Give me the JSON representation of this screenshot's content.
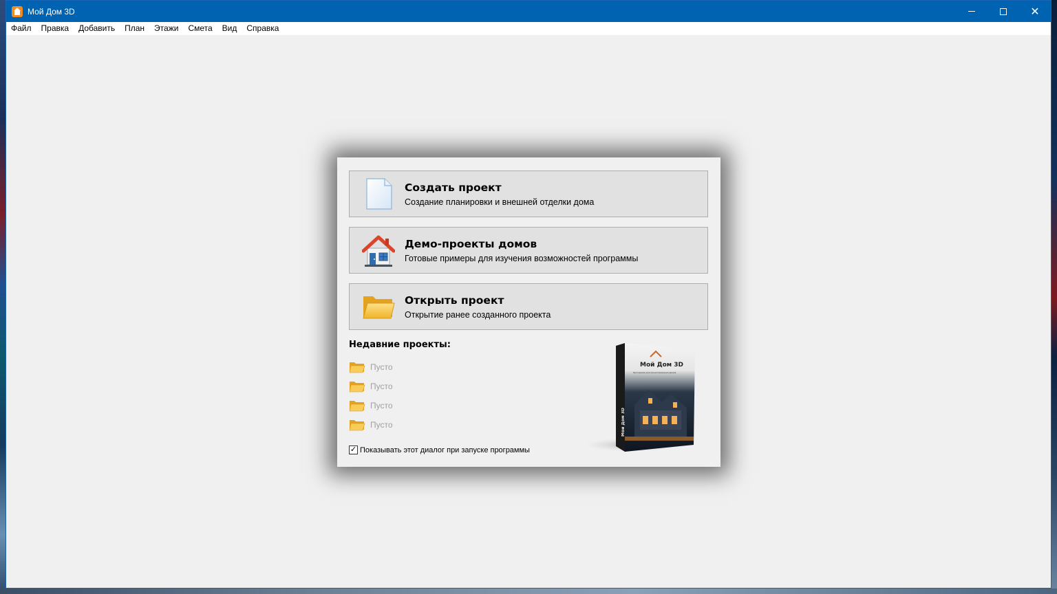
{
  "window": {
    "title": "Мой Дом 3D",
    "controls": {
      "minimize": "—",
      "maximize": "☐",
      "close": "✕"
    }
  },
  "menu": {
    "items": [
      "Файл",
      "Правка",
      "Добавить",
      "План",
      "Этажи",
      "Смета",
      "Вид",
      "Справка"
    ]
  },
  "dialog": {
    "actions": [
      {
        "title": "Создать проект",
        "subtitle": "Создание планировки и внешней отделки дома",
        "icon": "new-document-icon"
      },
      {
        "title": "Демо-проекты домов",
        "subtitle": "Готовые примеры для изучения возможностей программы",
        "icon": "house-icon"
      },
      {
        "title": "Открыть проект",
        "subtitle": "Открытие ранее созданного проекта",
        "icon": "open-folder-icon"
      }
    ],
    "recent_title": "Недавние проекты:",
    "recent": [
      "Пусто",
      "Пусто",
      "Пусто",
      "Пусто"
    ],
    "show_on_startup_label": "Показывать этот диалог при запуске программы",
    "show_on_startup_checked": true,
    "checkbox_mark": "✓",
    "box_brand": "Мой Дом 3D",
    "box_side": "Мой Дом 3D",
    "box_sub": "Программа для проектирования домов"
  },
  "colors": {
    "titlebar": "#0063b1",
    "button_face": "#e1e1e1",
    "button_border": "#adadad",
    "recent_text": "#a0a0a0",
    "folder_yellow": "#f6c13e"
  }
}
